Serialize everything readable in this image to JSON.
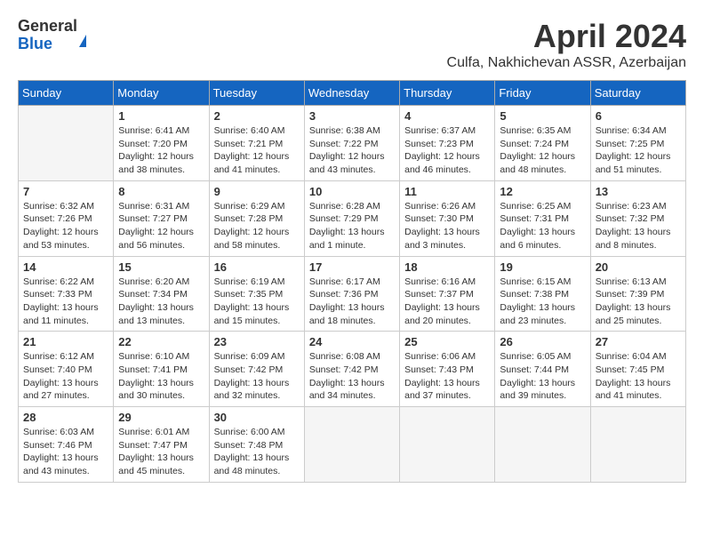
{
  "header": {
    "logo_line1": "General",
    "logo_line2": "Blue",
    "month": "April 2024",
    "location": "Culfa, Nakhichevan ASSR, Azerbaijan"
  },
  "weekdays": [
    "Sunday",
    "Monday",
    "Tuesday",
    "Wednesday",
    "Thursday",
    "Friday",
    "Saturday"
  ],
  "weeks": [
    [
      {
        "day": "",
        "empty": true
      },
      {
        "day": "1",
        "sunrise": "6:41 AM",
        "sunset": "7:20 PM",
        "daylight": "12 hours and 38 minutes."
      },
      {
        "day": "2",
        "sunrise": "6:40 AM",
        "sunset": "7:21 PM",
        "daylight": "12 hours and 41 minutes."
      },
      {
        "day": "3",
        "sunrise": "6:38 AM",
        "sunset": "7:22 PM",
        "daylight": "12 hours and 43 minutes."
      },
      {
        "day": "4",
        "sunrise": "6:37 AM",
        "sunset": "7:23 PM",
        "daylight": "12 hours and 46 minutes."
      },
      {
        "day": "5",
        "sunrise": "6:35 AM",
        "sunset": "7:24 PM",
        "daylight": "12 hours and 48 minutes."
      },
      {
        "day": "6",
        "sunrise": "6:34 AM",
        "sunset": "7:25 PM",
        "daylight": "12 hours and 51 minutes."
      }
    ],
    [
      {
        "day": "7",
        "sunrise": "6:32 AM",
        "sunset": "7:26 PM",
        "daylight": "12 hours and 53 minutes."
      },
      {
        "day": "8",
        "sunrise": "6:31 AM",
        "sunset": "7:27 PM",
        "daylight": "12 hours and 56 minutes."
      },
      {
        "day": "9",
        "sunrise": "6:29 AM",
        "sunset": "7:28 PM",
        "daylight": "12 hours and 58 minutes."
      },
      {
        "day": "10",
        "sunrise": "6:28 AM",
        "sunset": "7:29 PM",
        "daylight": "13 hours and 1 minute."
      },
      {
        "day": "11",
        "sunrise": "6:26 AM",
        "sunset": "7:30 PM",
        "daylight": "13 hours and 3 minutes."
      },
      {
        "day": "12",
        "sunrise": "6:25 AM",
        "sunset": "7:31 PM",
        "daylight": "13 hours and 6 minutes."
      },
      {
        "day": "13",
        "sunrise": "6:23 AM",
        "sunset": "7:32 PM",
        "daylight": "13 hours and 8 minutes."
      }
    ],
    [
      {
        "day": "14",
        "sunrise": "6:22 AM",
        "sunset": "7:33 PM",
        "daylight": "13 hours and 11 minutes."
      },
      {
        "day": "15",
        "sunrise": "6:20 AM",
        "sunset": "7:34 PM",
        "daylight": "13 hours and 13 minutes."
      },
      {
        "day": "16",
        "sunrise": "6:19 AM",
        "sunset": "7:35 PM",
        "daylight": "13 hours and 15 minutes."
      },
      {
        "day": "17",
        "sunrise": "6:17 AM",
        "sunset": "7:36 PM",
        "daylight": "13 hours and 18 minutes."
      },
      {
        "day": "18",
        "sunrise": "6:16 AM",
        "sunset": "7:37 PM",
        "daylight": "13 hours and 20 minutes."
      },
      {
        "day": "19",
        "sunrise": "6:15 AM",
        "sunset": "7:38 PM",
        "daylight": "13 hours and 23 minutes."
      },
      {
        "day": "20",
        "sunrise": "6:13 AM",
        "sunset": "7:39 PM",
        "daylight": "13 hours and 25 minutes."
      }
    ],
    [
      {
        "day": "21",
        "sunrise": "6:12 AM",
        "sunset": "7:40 PM",
        "daylight": "13 hours and 27 minutes."
      },
      {
        "day": "22",
        "sunrise": "6:10 AM",
        "sunset": "7:41 PM",
        "daylight": "13 hours and 30 minutes."
      },
      {
        "day": "23",
        "sunrise": "6:09 AM",
        "sunset": "7:42 PM",
        "daylight": "13 hours and 32 minutes."
      },
      {
        "day": "24",
        "sunrise": "6:08 AM",
        "sunset": "7:42 PM",
        "daylight": "13 hours and 34 minutes."
      },
      {
        "day": "25",
        "sunrise": "6:06 AM",
        "sunset": "7:43 PM",
        "daylight": "13 hours and 37 minutes."
      },
      {
        "day": "26",
        "sunrise": "6:05 AM",
        "sunset": "7:44 PM",
        "daylight": "13 hours and 39 minutes."
      },
      {
        "day": "27",
        "sunrise": "6:04 AM",
        "sunset": "7:45 PM",
        "daylight": "13 hours and 41 minutes."
      }
    ],
    [
      {
        "day": "28",
        "sunrise": "6:03 AM",
        "sunset": "7:46 PM",
        "daylight": "13 hours and 43 minutes."
      },
      {
        "day": "29",
        "sunrise": "6:01 AM",
        "sunset": "7:47 PM",
        "daylight": "13 hours and 45 minutes."
      },
      {
        "day": "30",
        "sunrise": "6:00 AM",
        "sunset": "7:48 PM",
        "daylight": "13 hours and 48 minutes."
      },
      {
        "day": "",
        "empty": true
      },
      {
        "day": "",
        "empty": true
      },
      {
        "day": "",
        "empty": true
      },
      {
        "day": "",
        "empty": true
      }
    ]
  ]
}
